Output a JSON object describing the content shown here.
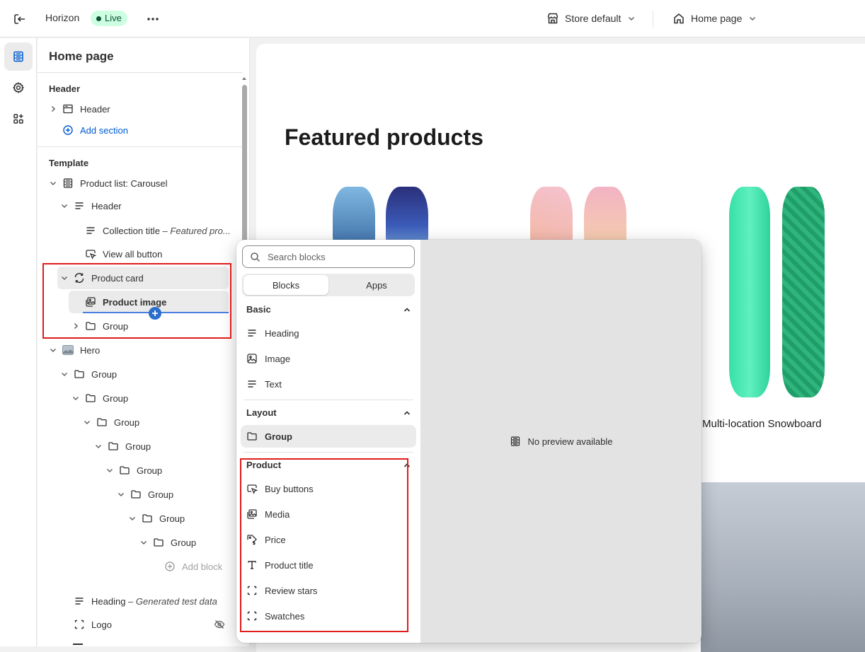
{
  "topbar": {
    "theme_name": "Horizon",
    "status_badge": "Live",
    "store_selector": "Store default",
    "page_selector": "Home page"
  },
  "sidebar": {
    "title": "Home page",
    "header_group_label": "Header",
    "header_section": "Header",
    "add_section": "Add section",
    "template_label": "Template",
    "items": {
      "product_list": "Product list: Carousel",
      "header": "Header",
      "collection_title": "Collection title",
      "collection_title_sub": "Featured pro...",
      "view_all": "View all button",
      "product_card": "Product card",
      "product_image": "Product image",
      "group": "Group",
      "hero": "Hero",
      "hero_groups": [
        "Group",
        "Group",
        "Group",
        "Group",
        "Group",
        "Group",
        "Group",
        "Group"
      ],
      "add_block": "Add block",
      "heading": "Heading",
      "heading_sub": "Generated test data",
      "logo": "Logo"
    }
  },
  "preview": {
    "title": "Featured products",
    "product_name": "Multi-location Snowboard"
  },
  "picker": {
    "search_placeholder": "Search blocks",
    "tabs": [
      "Blocks",
      "Apps"
    ],
    "categories": {
      "basic": "Basic",
      "layout": "Layout",
      "product": "Product"
    },
    "basic_items": [
      "Heading",
      "Image",
      "Text"
    ],
    "layout_items": [
      "Group"
    ],
    "product_items": [
      "Buy buttons",
      "Media",
      "Price",
      "Product title",
      "Review stars",
      "Swatches"
    ],
    "no_preview": "No preview available"
  },
  "colors": {
    "accent": "#005bd3",
    "live_badge_bg": "#cdfee1",
    "annotation_red": "#e01b1b"
  }
}
